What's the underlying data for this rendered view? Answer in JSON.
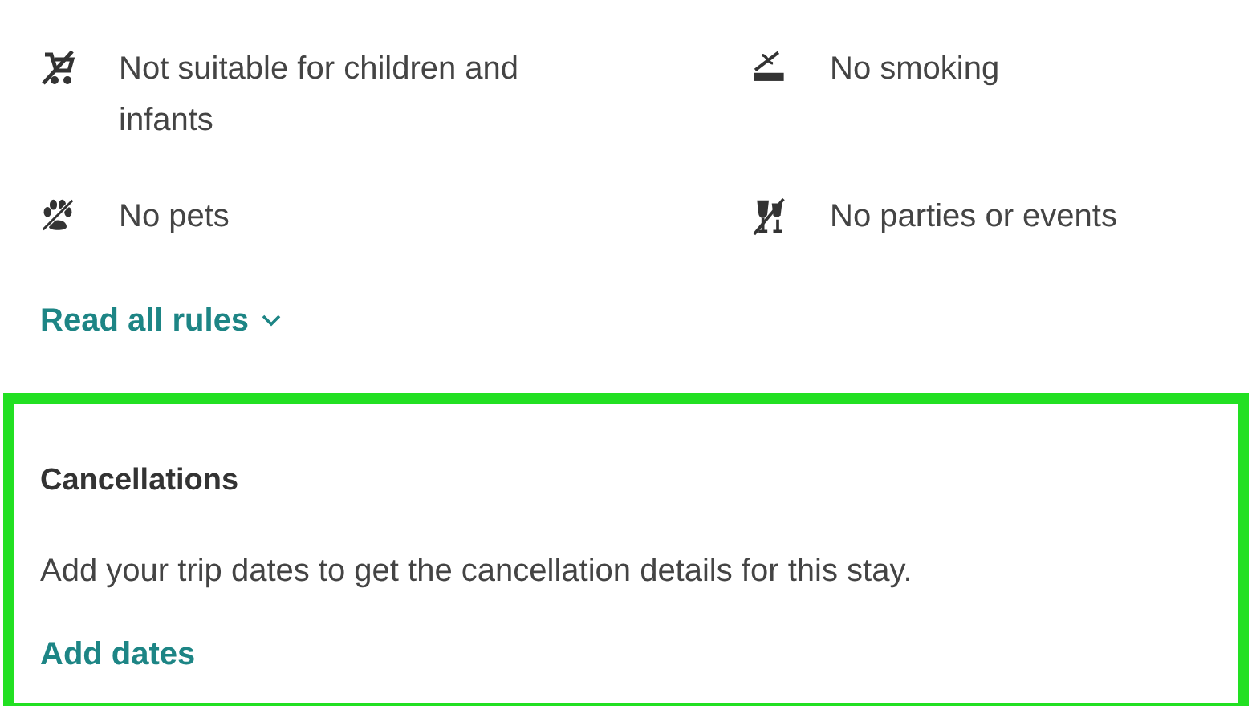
{
  "rules": [
    {
      "kind": "no-children",
      "label": "Not suitable for children and infants"
    },
    {
      "kind": "no-smoking",
      "label": "No smoking"
    },
    {
      "kind": "no-pets",
      "label": "No pets"
    },
    {
      "kind": "no-parties",
      "label": "No parties or events"
    }
  ],
  "read_all_link": "Read all rules",
  "cancellations": {
    "title": "Cancellations",
    "text": "Add your trip dates to get the cancellation details for this stay.",
    "link": "Add dates"
  }
}
